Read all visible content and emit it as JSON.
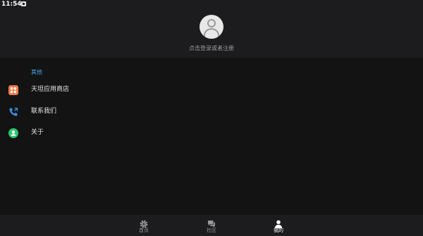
{
  "status_bar": {
    "time": "11:54",
    "notification_icon": "notification-icon"
  },
  "profile": {
    "avatar_icon": "default-avatar-icon",
    "login_prompt": "点击登录或者注册"
  },
  "section": {
    "title": "其他"
  },
  "menu": [
    {
      "label": "天坦应用商店",
      "icon": "app-store-icon",
      "color": "#f07c4a"
    },
    {
      "label": "联系我们",
      "icon": "phone-icon",
      "color": "#3a8fe0"
    },
    {
      "label": "关于",
      "icon": "about-user-icon",
      "color": "#2fc46e"
    }
  ],
  "bottom_nav": {
    "active": "我的",
    "items": [
      {
        "label": "首页",
        "icon": "home-gear-icon"
      },
      {
        "label": "社区",
        "icon": "community-chat-icon"
      },
      {
        "label": "我的",
        "icon": "profile-person-icon"
      }
    ]
  },
  "colors": {
    "background": "#131313",
    "surface": "#1c1c1e",
    "accent": "#4aa3e8"
  }
}
